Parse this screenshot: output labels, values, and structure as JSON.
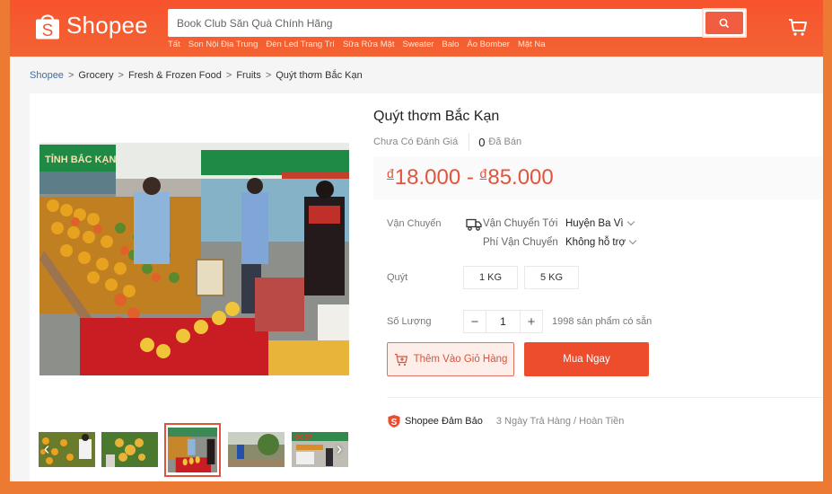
{
  "header": {
    "logo_text": "Shopee",
    "search": {
      "placeholder": "Book Club Săn Quà Chính Hãng",
      "value": ""
    },
    "suggestions": [
      "Tất",
      "Son Nội Địa Trung",
      "Đèn Led Trang Trí",
      "Sữa Rửa Mặt",
      "Sweater",
      "Balo",
      "Áo Bomber",
      "Mặt Na"
    ]
  },
  "breadcrumb": {
    "items": [
      "Shopee",
      "Grocery",
      "Fresh & Frozen Food",
      "Fruits",
      "Quýt thơm Bắc Kạn"
    ],
    "separator": ">"
  },
  "gallery": {
    "thumbnail_count": 5,
    "active_thumbnail_index": 2,
    "prev_arrow": "‹",
    "next_arrow": "›"
  },
  "product": {
    "title": "Quýt thơm Bắc Kạn",
    "rating_text": "Chưa Có Đánh Giá",
    "sold_count": "0",
    "sold_label": "Đã Bán",
    "price": {
      "currency_symbol": "đ",
      "min": "18.000",
      "separator": "-",
      "max": "85.000"
    },
    "shipping": {
      "label": "Vận Chuyển",
      "ship_to_label": "Vận Chuyển Tới",
      "ship_to_value": "Huyện Ba Vì",
      "fee_label": "Phí Vận Chuyển",
      "fee_value": "Không hỗ trợ"
    },
    "variant": {
      "label": "Quýt",
      "options": [
        "1 KG",
        "5 KG"
      ]
    },
    "quantity": {
      "label": "Số Lượng",
      "value": "1",
      "minus": "−",
      "plus": "+",
      "stock_text": "1998 sản phẩm có sẵn"
    },
    "add_to_cart_label": "Thêm Vào Giỏ Hàng",
    "buy_now_label": "Mua Ngay",
    "guarantee": {
      "title": "Shopee Đảm Bảo",
      "description": "3 Ngày Trả Hàng / Hoàn Tiền"
    }
  },
  "colors": {
    "brand": "#ee4d2d",
    "price": "#e4533b",
    "frame": "#ec7a32"
  }
}
